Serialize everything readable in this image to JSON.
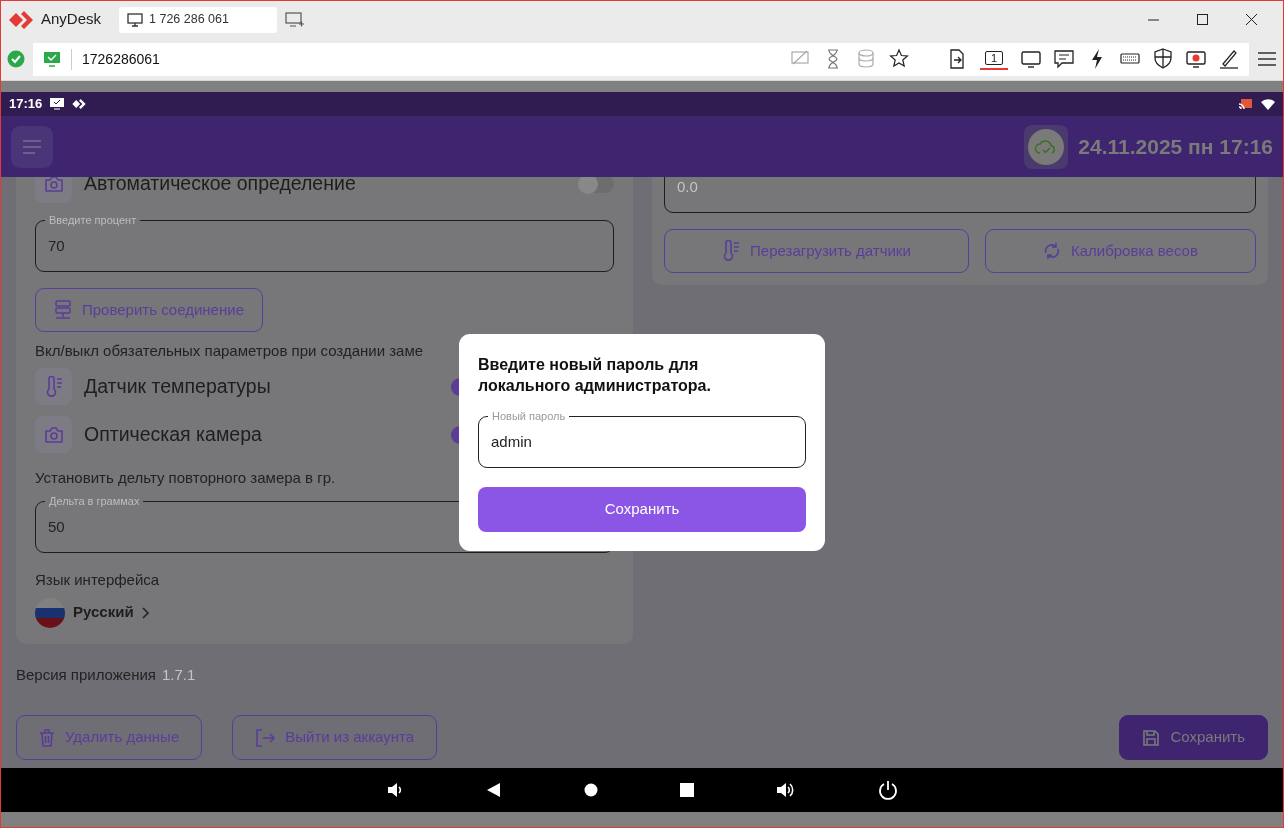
{
  "window": {
    "app_name": "AnyDesk",
    "tab_label": "1 726 286 061"
  },
  "address_bar": {
    "address": "1726286061",
    "display_button": {
      "label": "1",
      "selected": true
    }
  },
  "status_bar": {
    "time": "17:16"
  },
  "header": {
    "datetime": "24.11.2025 пн 17:16"
  },
  "left_card": [
    {
      "kind": "toggle",
      "label": "Автоматическое определение",
      "on": false
    },
    {
      "kind": "field",
      "label": "Введите процент",
      "value": "70"
    },
    {
      "kind": "button",
      "label": "Проверить соединение"
    },
    {
      "kind": "note",
      "text": "Вкл/выкл обязательных параметров при создании заме"
    },
    {
      "kind": "toggle",
      "label": "Датчик температуры",
      "on": true
    },
    {
      "kind": "toggle",
      "label": "Оптическая камера",
      "on": true
    },
    {
      "kind": "note",
      "text": "Установить дельту повторного замера в гр."
    },
    {
      "kind": "field",
      "label": "Дельта в граммах",
      "value": "50"
    },
    {
      "kind": "note",
      "text": "Язык интерфейса"
    },
    {
      "kind": "language",
      "label": "Русский"
    }
  ],
  "right_card": {
    "field_value": "0.0",
    "buttons": [
      "Перезагрузить датчики",
      "Калибровка весов"
    ]
  },
  "version": {
    "label": "Версия приложения",
    "value": "1.7.1"
  },
  "footer_buttons": [
    {
      "kind": "delete",
      "label": "Удалить данные"
    },
    {
      "kind": "logout",
      "label": "Выйти из аккаунта"
    },
    {
      "kind": "save",
      "label": "Сохранить"
    }
  ],
  "dialog": {
    "title": "Введите новый пароль для локального администратора.",
    "field_label": "Новый пароль",
    "field_value": "admin",
    "button": "Сохранить"
  }
}
